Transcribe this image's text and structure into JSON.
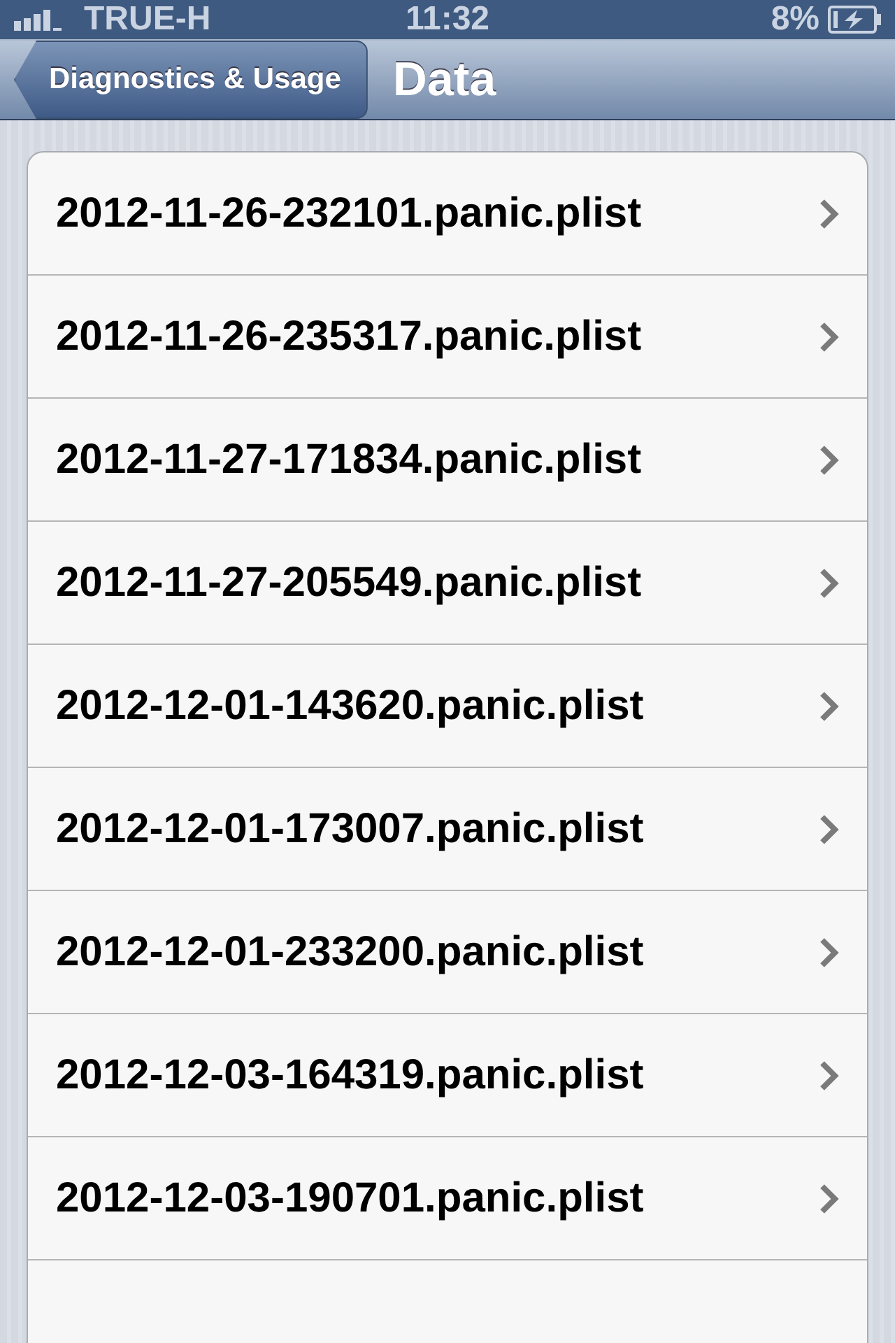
{
  "status_bar": {
    "carrier": "TRUE-H",
    "time": "11:32",
    "battery": "8%"
  },
  "nav_bar": {
    "back_button": "Diagnostics & Usage",
    "title": "Data"
  },
  "files": [
    {
      "name": "2012-11-26-232101.panic.plist"
    },
    {
      "name": "2012-11-26-235317.panic.plist"
    },
    {
      "name": "2012-11-27-171834.panic.plist"
    },
    {
      "name": "2012-11-27-205549.panic.plist"
    },
    {
      "name": "2012-12-01-143620.panic.plist"
    },
    {
      "name": "2012-12-01-173007.panic.plist"
    },
    {
      "name": "2012-12-01-233200.panic.plist"
    },
    {
      "name": "2012-12-03-164319.panic.plist"
    },
    {
      "name": "2012-12-03-190701.panic.plist"
    }
  ]
}
